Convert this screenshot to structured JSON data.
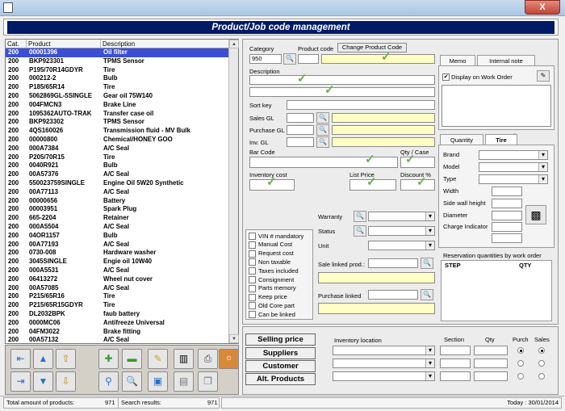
{
  "window": {
    "close_glyph": "X"
  },
  "header": {
    "title": "Product/Job code management"
  },
  "grid": {
    "columns": [
      "Cat.",
      "Product",
      "Description"
    ],
    "selected_index": 0,
    "rows": [
      [
        "200",
        "00001396",
        "Oil filter"
      ],
      [
        "200",
        "BKP923301",
        "TPMS Sensor"
      ],
      [
        "200",
        "P195/70R14GDYR",
        "Tire"
      ],
      [
        "200",
        "000212-2",
        "Bulb"
      ],
      [
        "200",
        "P185/65R14",
        "Tire"
      ],
      [
        "200",
        "5062869GL-5SINGLE",
        "Gear oil 75W140"
      ],
      [
        "200",
        "004FMCN3",
        "Brake Line"
      ],
      [
        "200",
        "1095362AUTO-TRAK",
        "Transfer case oil"
      ],
      [
        "200",
        "BKP923302",
        "TPMS Sensor"
      ],
      [
        "200",
        "4QS160026",
        "Transmission fluid - MV Bulk"
      ],
      [
        "200",
        "00000800",
        "Chemical/HONEY GOO"
      ],
      [
        "200",
        "000A7384",
        "A/C Seal"
      ],
      [
        "200",
        "P205/70R15",
        "Tire"
      ],
      [
        "200",
        "0040R921",
        "Bulb"
      ],
      [
        "200",
        "00A57376",
        "A/C Seal"
      ],
      [
        "200",
        "550023759SINGLE",
        "Engine Oil 5W20 Synthetic"
      ],
      [
        "200",
        "00A77113",
        "A/C Seal"
      ],
      [
        "200",
        "00000656",
        "Battery"
      ],
      [
        "200",
        "00003951",
        "Spark Plug"
      ],
      [
        "200",
        "665-2204",
        "Retainer"
      ],
      [
        "200",
        "000A5504",
        "A/C Seal"
      ],
      [
        "200",
        "04OR1157",
        "Bulb"
      ],
      [
        "200",
        "00A77193",
        "A/C Seal"
      ],
      [
        "200",
        "0730-008",
        "Hardware washer"
      ],
      [
        "200",
        "3045SINGLE",
        "Engie oil 10W40"
      ],
      [
        "200",
        "000A5531",
        "A/C Seal"
      ],
      [
        "200",
        "06413272",
        "Wheel nut cover"
      ],
      [
        "200",
        "00A57085",
        "A/C Seal"
      ],
      [
        "200",
        "P215/65R16",
        "Tire"
      ],
      [
        "200",
        "P215/65R15GDYR",
        "Tire"
      ],
      [
        "200",
        "DL2032BPK",
        "faub battery"
      ],
      [
        "200",
        "0000MC06",
        "Antifreeze Universal"
      ],
      [
        "200",
        "04FM3022",
        "Brake fitting"
      ],
      [
        "200",
        "00A57132",
        "A/C Seal"
      ]
    ]
  },
  "form": {
    "category_label": "Category",
    "category_value": "950",
    "product_code_label": "Product code",
    "change_code_button": "Change Product Code",
    "description_label": "Description",
    "sort_key_label": "Sort key",
    "sales_gl_label": "Sales GL",
    "purchase_gl_label": "Purchase GL",
    "inv_gl_label": "Inv. GL",
    "barcode_label": "Bar Code",
    "qty_case_label": "Qty / Case",
    "inventory_cost_label": "Inventory cost",
    "list_price_label": "List Price",
    "discount_label": "Discount %",
    "checkboxes": [
      "VIN # mandatory",
      "Manual Cost",
      "Request cost",
      "Non taxable",
      "Taxes included",
      "Consignment",
      "Parts memory",
      "Keep price",
      "Old Core part",
      "Can be linked"
    ],
    "warranty_label": "Warranty",
    "status_label": "Status",
    "unit_label": "Unit",
    "sale_linked_label": "Sale linked prod.:",
    "purchase_linked_label": "Purchase linked",
    "memo_tab": "Memo",
    "internal_note_tab": "Internal note",
    "display_on_wo": "Display on Work Order",
    "quantity_tab": "Quantity",
    "tire_tab": "Tire",
    "tire_fields": [
      "Brand",
      "Model",
      "Type",
      "Width",
      "Side wall height",
      "Diameter",
      "Charge Indicator"
    ],
    "reservation_title": "Reservation quantities by work order",
    "reservation_cols": [
      "STEP",
      "QTY"
    ]
  },
  "bottom": {
    "nav_buttons": [
      "Selling price",
      "Suppliers",
      "Customer",
      "Alt. Products"
    ],
    "inv_location_label": "Inventory location",
    "section_label": "Section",
    "qty_label": "Qty",
    "purch_label": "Purch",
    "sales_label": "Sales"
  },
  "status": {
    "total_label": "Total amount of products:",
    "total_value": "971",
    "search_label": "Search results:",
    "search_value": "971",
    "today": "Today : 30/01/2014"
  },
  "colors": {
    "header_bg": "#001a66",
    "selection": "#3a4fd6",
    "highlight_yellow": "#ffffc4",
    "check_green": "#6ab04c"
  }
}
